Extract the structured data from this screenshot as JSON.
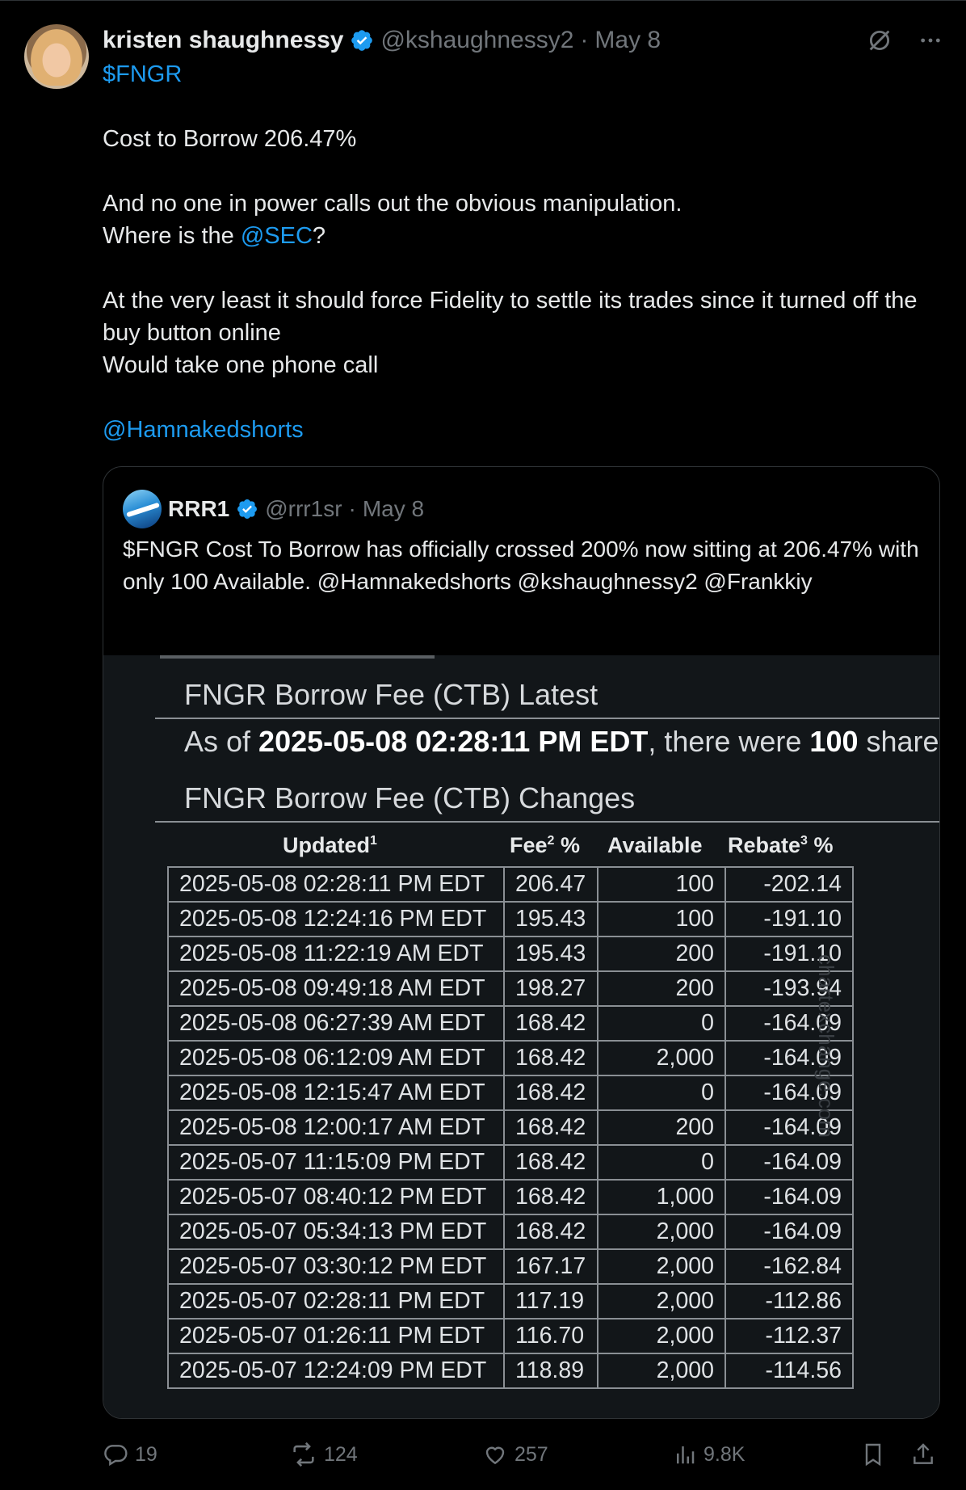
{
  "author": {
    "name": "kristen shaughnessy",
    "handle": "@kshaughnessy2",
    "separator": "·",
    "date": "May 8"
  },
  "tweet": {
    "cashtag": "$FNGR",
    "line1": "Cost to Borrow 206.47%",
    "line2": "And no one in power calls out the obvious manipulation.",
    "line3_pre": "Where is the ",
    "line3_mention": "@SEC",
    "line3_post": "?",
    "line4": "At the very least it should force Fidelity to settle its trades since it turned off the buy button online",
    "line5": "Would take one phone call",
    "mention_last": "@Hamnakedshorts"
  },
  "quote": {
    "name": "RRR1",
    "handle": "@rrr1sr",
    "separator": "·",
    "date": "May 8",
    "text": "$FNGR Cost To Borrow has officially crossed 200% now sitting at 206.47% with only 100 Available. @Hamnakedshorts @kshaughnessy2 @Frankkiy"
  },
  "ctb": {
    "latest_title": "FNGR Borrow Fee (CTB) Latest",
    "asof_pre": "As of ",
    "asof_time": "2025-05-08 02:28:11 PM EDT",
    "asof_mid": ", there were ",
    "asof_count": "100",
    "asof_post": " share",
    "changes_title": "FNGR Borrow Fee (CTB) Changes",
    "headers": {
      "updated": "Updated",
      "updated_sup": "1",
      "fee": "Fee",
      "fee_sup": "2",
      "fee_pct": " %",
      "available": "Available",
      "rebate": "Rebate",
      "rebate_sup": "3",
      "rebate_pct": " %"
    },
    "watermark": "chartexchange.com",
    "rows": [
      [
        "2025-05-08 02:28:11 PM EDT",
        "206.47",
        "100",
        "-202.14"
      ],
      [
        "2025-05-08 12:24:16 PM EDT",
        "195.43",
        "100",
        "-191.10"
      ],
      [
        "2025-05-08 11:22:19 AM EDT",
        "195.43",
        "200",
        "-191.10"
      ],
      [
        "2025-05-08 09:49:18 AM EDT",
        "198.27",
        "200",
        "-193.94"
      ],
      [
        "2025-05-08 06:27:39 AM EDT",
        "168.42",
        "0",
        "-164.09"
      ],
      [
        "2025-05-08 06:12:09 AM EDT",
        "168.42",
        "2,000",
        "-164.09"
      ],
      [
        "2025-05-08 12:15:47 AM EDT",
        "168.42",
        "0",
        "-164.09"
      ],
      [
        "2025-05-08 12:00:17 AM EDT",
        "168.42",
        "200",
        "-164.09"
      ],
      [
        "2025-05-07 11:15:09 PM EDT",
        "168.42",
        "0",
        "-164.09"
      ],
      [
        "2025-05-07 08:40:12 PM EDT",
        "168.42",
        "1,000",
        "-164.09"
      ],
      [
        "2025-05-07 05:34:13 PM EDT",
        "168.42",
        "2,000",
        "-164.09"
      ],
      [
        "2025-05-07 03:30:12 PM EDT",
        "167.17",
        "2,000",
        "-162.84"
      ],
      [
        "2025-05-07 02:28:11 PM EDT",
        "117.19",
        "2,000",
        "-112.86"
      ],
      [
        "2025-05-07 01:26:11 PM EDT",
        "116.70",
        "2,000",
        "-112.37"
      ],
      [
        "2025-05-07 12:24:09 PM EDT",
        "118.89",
        "2,000",
        "-114.56"
      ]
    ]
  },
  "actions": {
    "replies": "19",
    "reposts": "124",
    "likes": "257",
    "views": "9.8K"
  },
  "colors": {
    "background": "#000000",
    "text": "#e7e9ea",
    "secondary": "#71767b",
    "link": "#1d9bf0",
    "verified": "#1d9bf0"
  }
}
